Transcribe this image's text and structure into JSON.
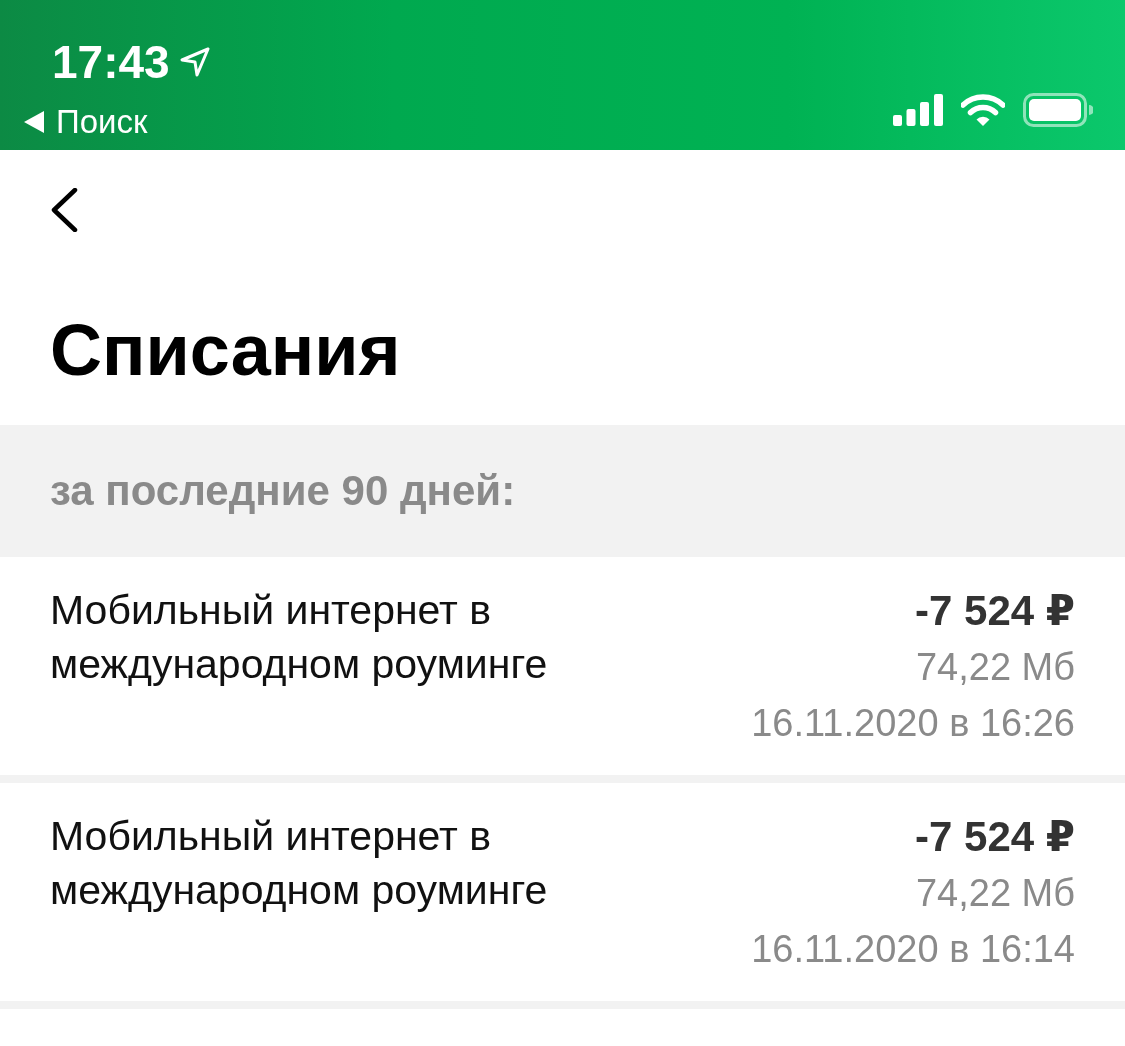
{
  "status_bar": {
    "time": "17:43",
    "back_app": "Поиск"
  },
  "header": {
    "title": "Списания"
  },
  "section": {
    "caption": "за последние 90 дней:"
  },
  "charges": [
    {
      "title": "Мобильный интернет в международном роуминге",
      "amount": "-7 524 ₽",
      "volume": "74,22 Мб",
      "date": "16.11.2020 в 16:26"
    },
    {
      "title": "Мобильный интернет в международном роуминге",
      "amount": "-7 524 ₽",
      "volume": "74,22 Мб",
      "date": "16.11.2020 в 16:14"
    }
  ]
}
